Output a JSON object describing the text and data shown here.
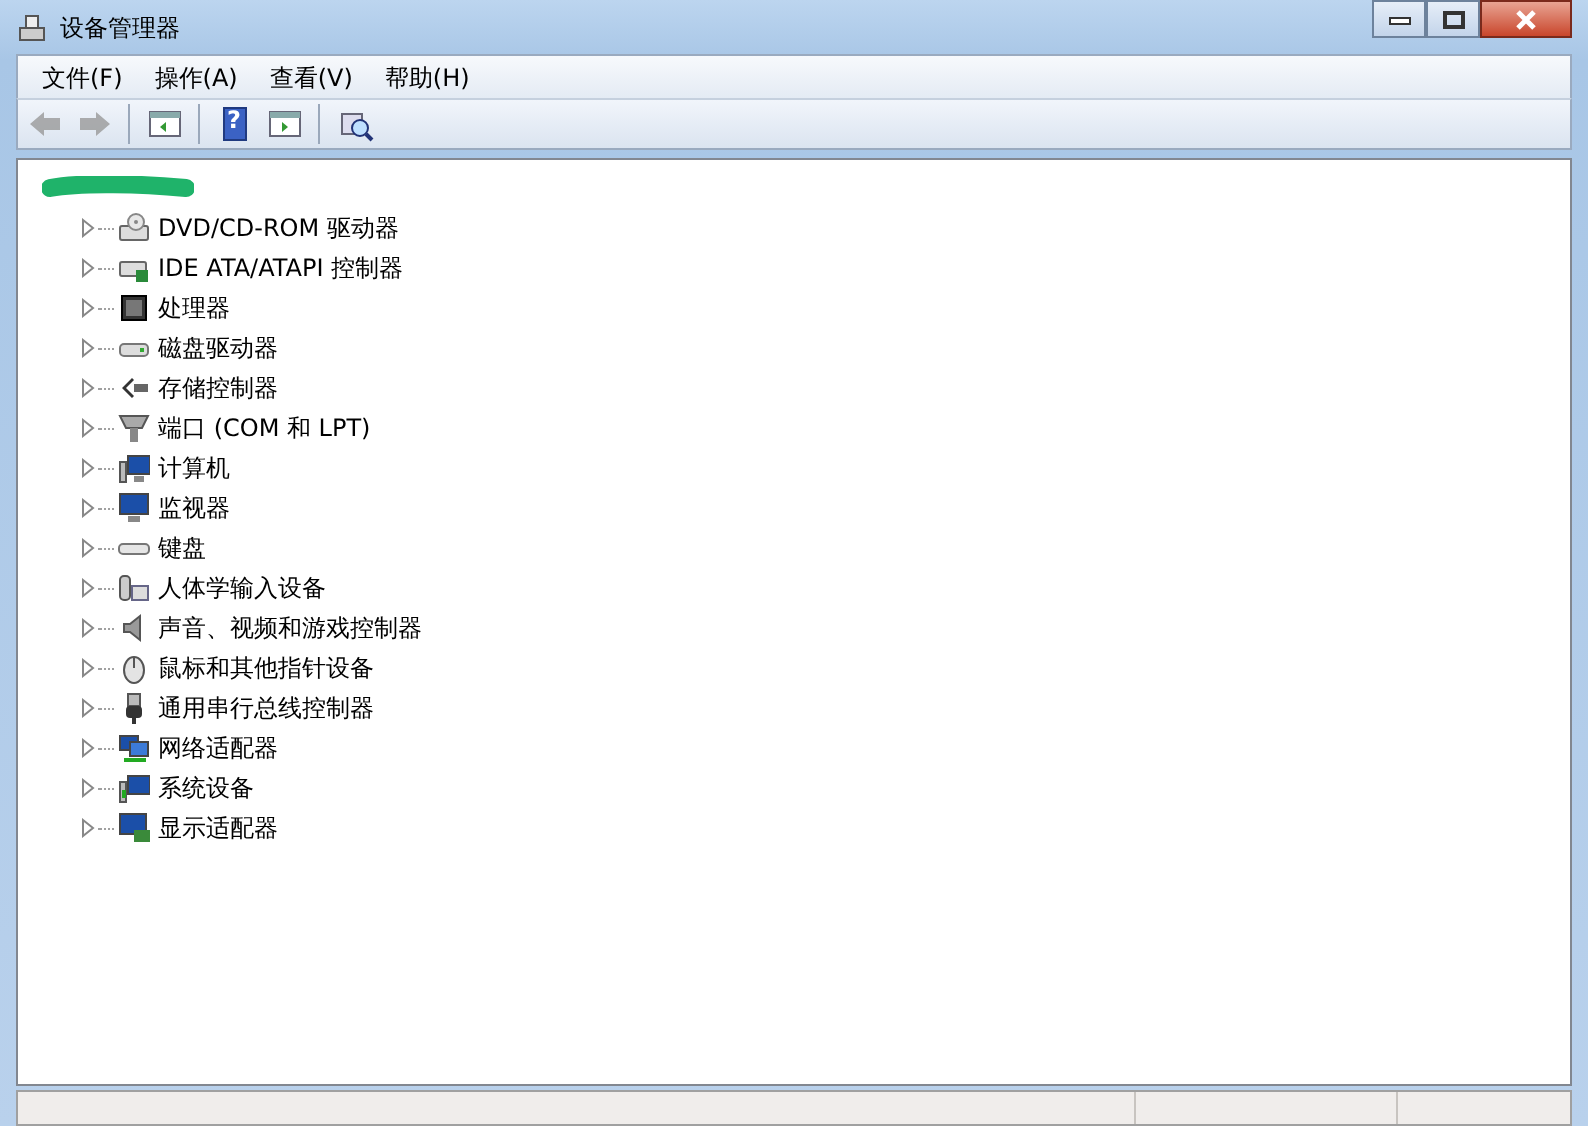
{
  "window": {
    "title": "设备管理器"
  },
  "menu": [
    "文件(F)",
    "操作(A)",
    "查看(V)",
    "帮助(H)"
  ],
  "toolbar": [
    {
      "kind": "back",
      "disabled": true
    },
    {
      "kind": "forward",
      "disabled": true
    },
    {
      "kind": "sep"
    },
    {
      "kind": "console",
      "disabled": false
    },
    {
      "kind": "sep"
    },
    {
      "kind": "help",
      "glyph": "?",
      "disabled": false
    },
    {
      "kind": "pane",
      "disabled": false
    },
    {
      "kind": "sep"
    },
    {
      "kind": "scan",
      "disabled": false
    }
  ],
  "tree": {
    "root": {
      "redacted": true,
      "children": [
        {
          "label": "DVD/CD-ROM 驱动器",
          "kind": "disc",
          "expanded": false
        },
        {
          "label": "IDE ATA/ATAPI 控制器",
          "kind": "ide",
          "expanded": false
        },
        {
          "label": "处理器",
          "kind": "cpu",
          "expanded": false
        },
        {
          "label": "磁盘驱动器",
          "kind": "disk",
          "expanded": false
        },
        {
          "label": "存储控制器",
          "kind": "storage",
          "expanded": false
        },
        {
          "label": "端口 (COM 和 LPT)",
          "kind": "port",
          "expanded": false
        },
        {
          "label": "计算机",
          "kind": "computer",
          "expanded": false
        },
        {
          "label": "监视器",
          "kind": "monitor",
          "expanded": false
        },
        {
          "label": "键盘",
          "kind": "keyboard",
          "expanded": false
        },
        {
          "label": "人体学输入设备",
          "kind": "hid",
          "expanded": false
        },
        {
          "label": "声音、视频和游戏控制器",
          "kind": "sound",
          "expanded": false
        },
        {
          "label": "鼠标和其他指针设备",
          "kind": "mouse",
          "expanded": false
        },
        {
          "label": "通用串行总线控制器",
          "kind": "usb",
          "expanded": false
        },
        {
          "label": "网络适配器",
          "kind": "network",
          "expanded": false
        },
        {
          "label": "系统设备",
          "kind": "system",
          "expanded": false
        },
        {
          "label": "显示适配器",
          "kind": "display",
          "expanded": false
        }
      ]
    }
  }
}
